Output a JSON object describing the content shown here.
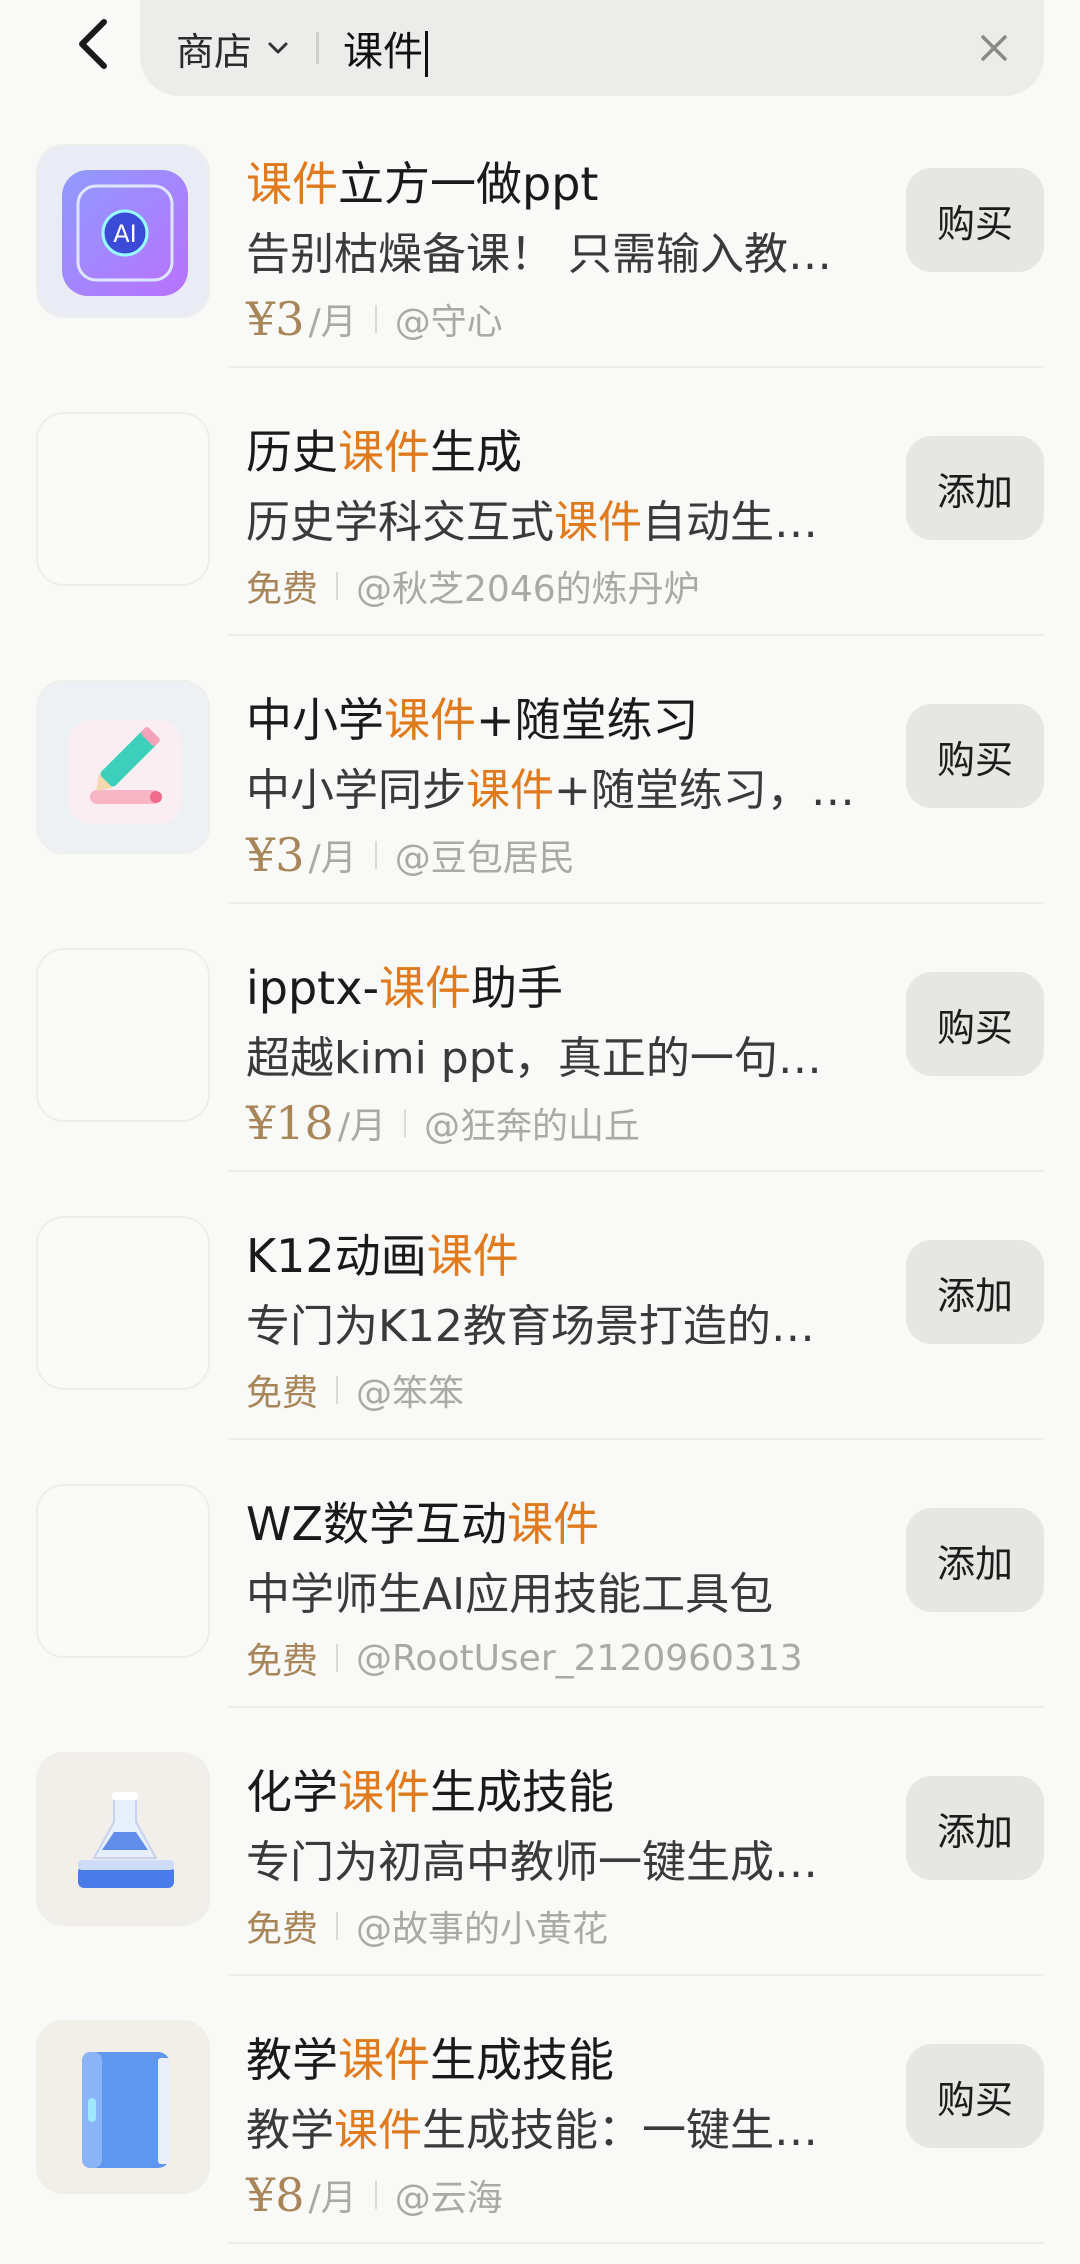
{
  "search": {
    "scope": "商店",
    "query": "课件"
  },
  "colors": {
    "highlight": "#e07a1c",
    "price": "#a8865a",
    "button_bg": "#e6e6e3"
  },
  "items": [
    {
      "icon": "cube-ai-icon",
      "title": [
        {
          "t": "课件",
          "hl": true
        },
        {
          "t": "立方一做ppt",
          "hl": false
        }
      ],
      "desc": [
        {
          "t": "告别枯燥备课！ 只需输入教…",
          "hl": false
        }
      ],
      "price": "¥3",
      "unit": "/月",
      "free": "",
      "author": "@守心",
      "button": "购买"
    },
    {
      "icon": "",
      "title": [
        {
          "t": "历史",
          "hl": false
        },
        {
          "t": "课件",
          "hl": true
        },
        {
          "t": "生成",
          "hl": false
        }
      ],
      "desc": [
        {
          "t": "历史学科交互式",
          "hl": false
        },
        {
          "t": "课件",
          "hl": true
        },
        {
          "t": "自动生…",
          "hl": false
        }
      ],
      "price": "",
      "unit": "",
      "free": "免费",
      "author": "@秋芝2046的炼丹炉",
      "button": "添加"
    },
    {
      "icon": "pencil-tablet-icon",
      "title": [
        {
          "t": "中小学",
          "hl": false
        },
        {
          "t": "课件",
          "hl": true
        },
        {
          "t": "+随堂练习",
          "hl": false
        }
      ],
      "desc": [
        {
          "t": "中小学同步",
          "hl": false
        },
        {
          "t": "课件",
          "hl": true
        },
        {
          "t": "+随堂练习，…",
          "hl": false
        }
      ],
      "price": "¥3",
      "unit": "/月",
      "free": "",
      "author": "@豆包居民",
      "button": "购买"
    },
    {
      "icon": "",
      "title": [
        {
          "t": "ipptx-",
          "hl": false
        },
        {
          "t": "课件",
          "hl": true
        },
        {
          "t": "助手",
          "hl": false
        }
      ],
      "desc": [
        {
          "t": "超越kimi ppt，真正的一句…",
          "hl": false
        }
      ],
      "price": "¥18",
      "unit": "/月",
      "free": "",
      "author": "@狂奔的山丘",
      "button": "购买"
    },
    {
      "icon": "",
      "title": [
        {
          "t": "K12动画",
          "hl": false
        },
        {
          "t": "课件",
          "hl": true
        }
      ],
      "desc": [
        {
          "t": "专门为K12教育场景打造的…",
          "hl": false
        }
      ],
      "price": "",
      "unit": "",
      "free": "免费",
      "author": "@笨笨",
      "button": "添加"
    },
    {
      "icon": "",
      "title": [
        {
          "t": "WZ数学互动",
          "hl": false
        },
        {
          "t": "课件",
          "hl": true
        }
      ],
      "desc": [
        {
          "t": "中学师生AI应用技能工具包",
          "hl": false
        }
      ],
      "price": "",
      "unit": "",
      "free": "免费",
      "author": "@RootUser_2120960313",
      "button": "添加"
    },
    {
      "icon": "flask-icon",
      "title": [
        {
          "t": "化学",
          "hl": false
        },
        {
          "t": "课件",
          "hl": true
        },
        {
          "t": "生成技能",
          "hl": false
        }
      ],
      "desc": [
        {
          "t": "专门为初高中教师一键生成…",
          "hl": false
        }
      ],
      "price": "",
      "unit": "",
      "free": "免费",
      "author": "@故事的小黄花",
      "button": "添加"
    },
    {
      "icon": "book-icon",
      "title": [
        {
          "t": "教学",
          "hl": false
        },
        {
          "t": "课件",
          "hl": true
        },
        {
          "t": "生成技能",
          "hl": false
        }
      ],
      "desc": [
        {
          "t": "教学",
          "hl": false
        },
        {
          "t": "课件",
          "hl": true
        },
        {
          "t": "生成技能：一键生…",
          "hl": false
        }
      ],
      "price": "¥8",
      "unit": "/月",
      "free": "",
      "author": "@云海",
      "button": "购买"
    }
  ]
}
